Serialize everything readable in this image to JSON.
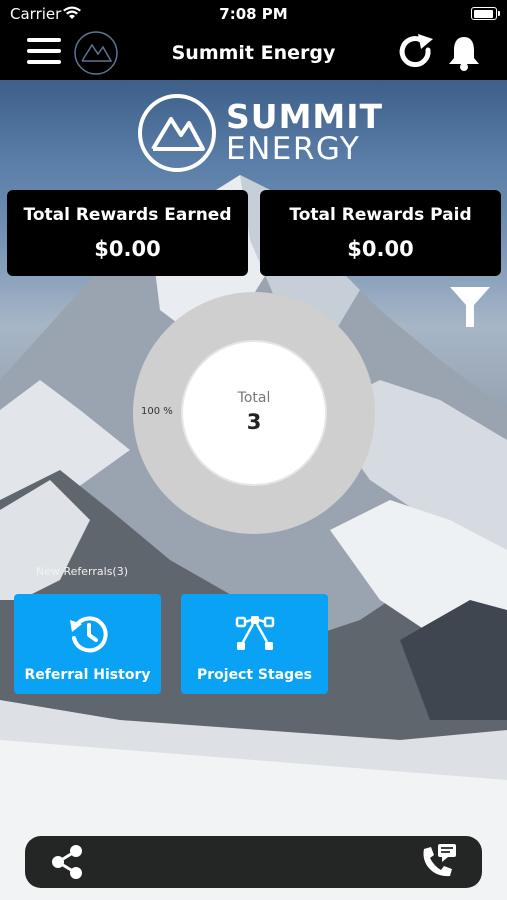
{
  "status_bar": {
    "carrier": "Carrier",
    "time": "7:08 PM"
  },
  "nav": {
    "title": "Summit Energy"
  },
  "brand": {
    "line1": "SUMMIT",
    "line2": "ENERGY"
  },
  "rewards": [
    {
      "label": "Total Rewards Earned",
      "value": "$0.00"
    },
    {
      "label": "Total Rewards Paid",
      "value": "$0.00"
    }
  ],
  "chart_data": {
    "type": "pie",
    "categories": [
      "New Referrals"
    ],
    "values": [
      3
    ],
    "percent_labels": [
      "100 %"
    ],
    "center_label": "Total",
    "center_value": "3",
    "legend": [
      "New Referrals(3)"
    ],
    "colors": [
      "#cfcfcf"
    ]
  },
  "tiles": [
    {
      "label": "Referral History",
      "icon": "history-icon"
    },
    {
      "label": "Project Stages",
      "icon": "workflow-icon"
    }
  ],
  "colors": {
    "accent": "#0aa2f5",
    "bar": "#000000"
  },
  "icons": [
    "wifi-icon",
    "battery-icon",
    "menu-icon",
    "logo-icon",
    "refresh-icon",
    "bell-icon",
    "filter-icon",
    "share-icon",
    "call-icon"
  ]
}
